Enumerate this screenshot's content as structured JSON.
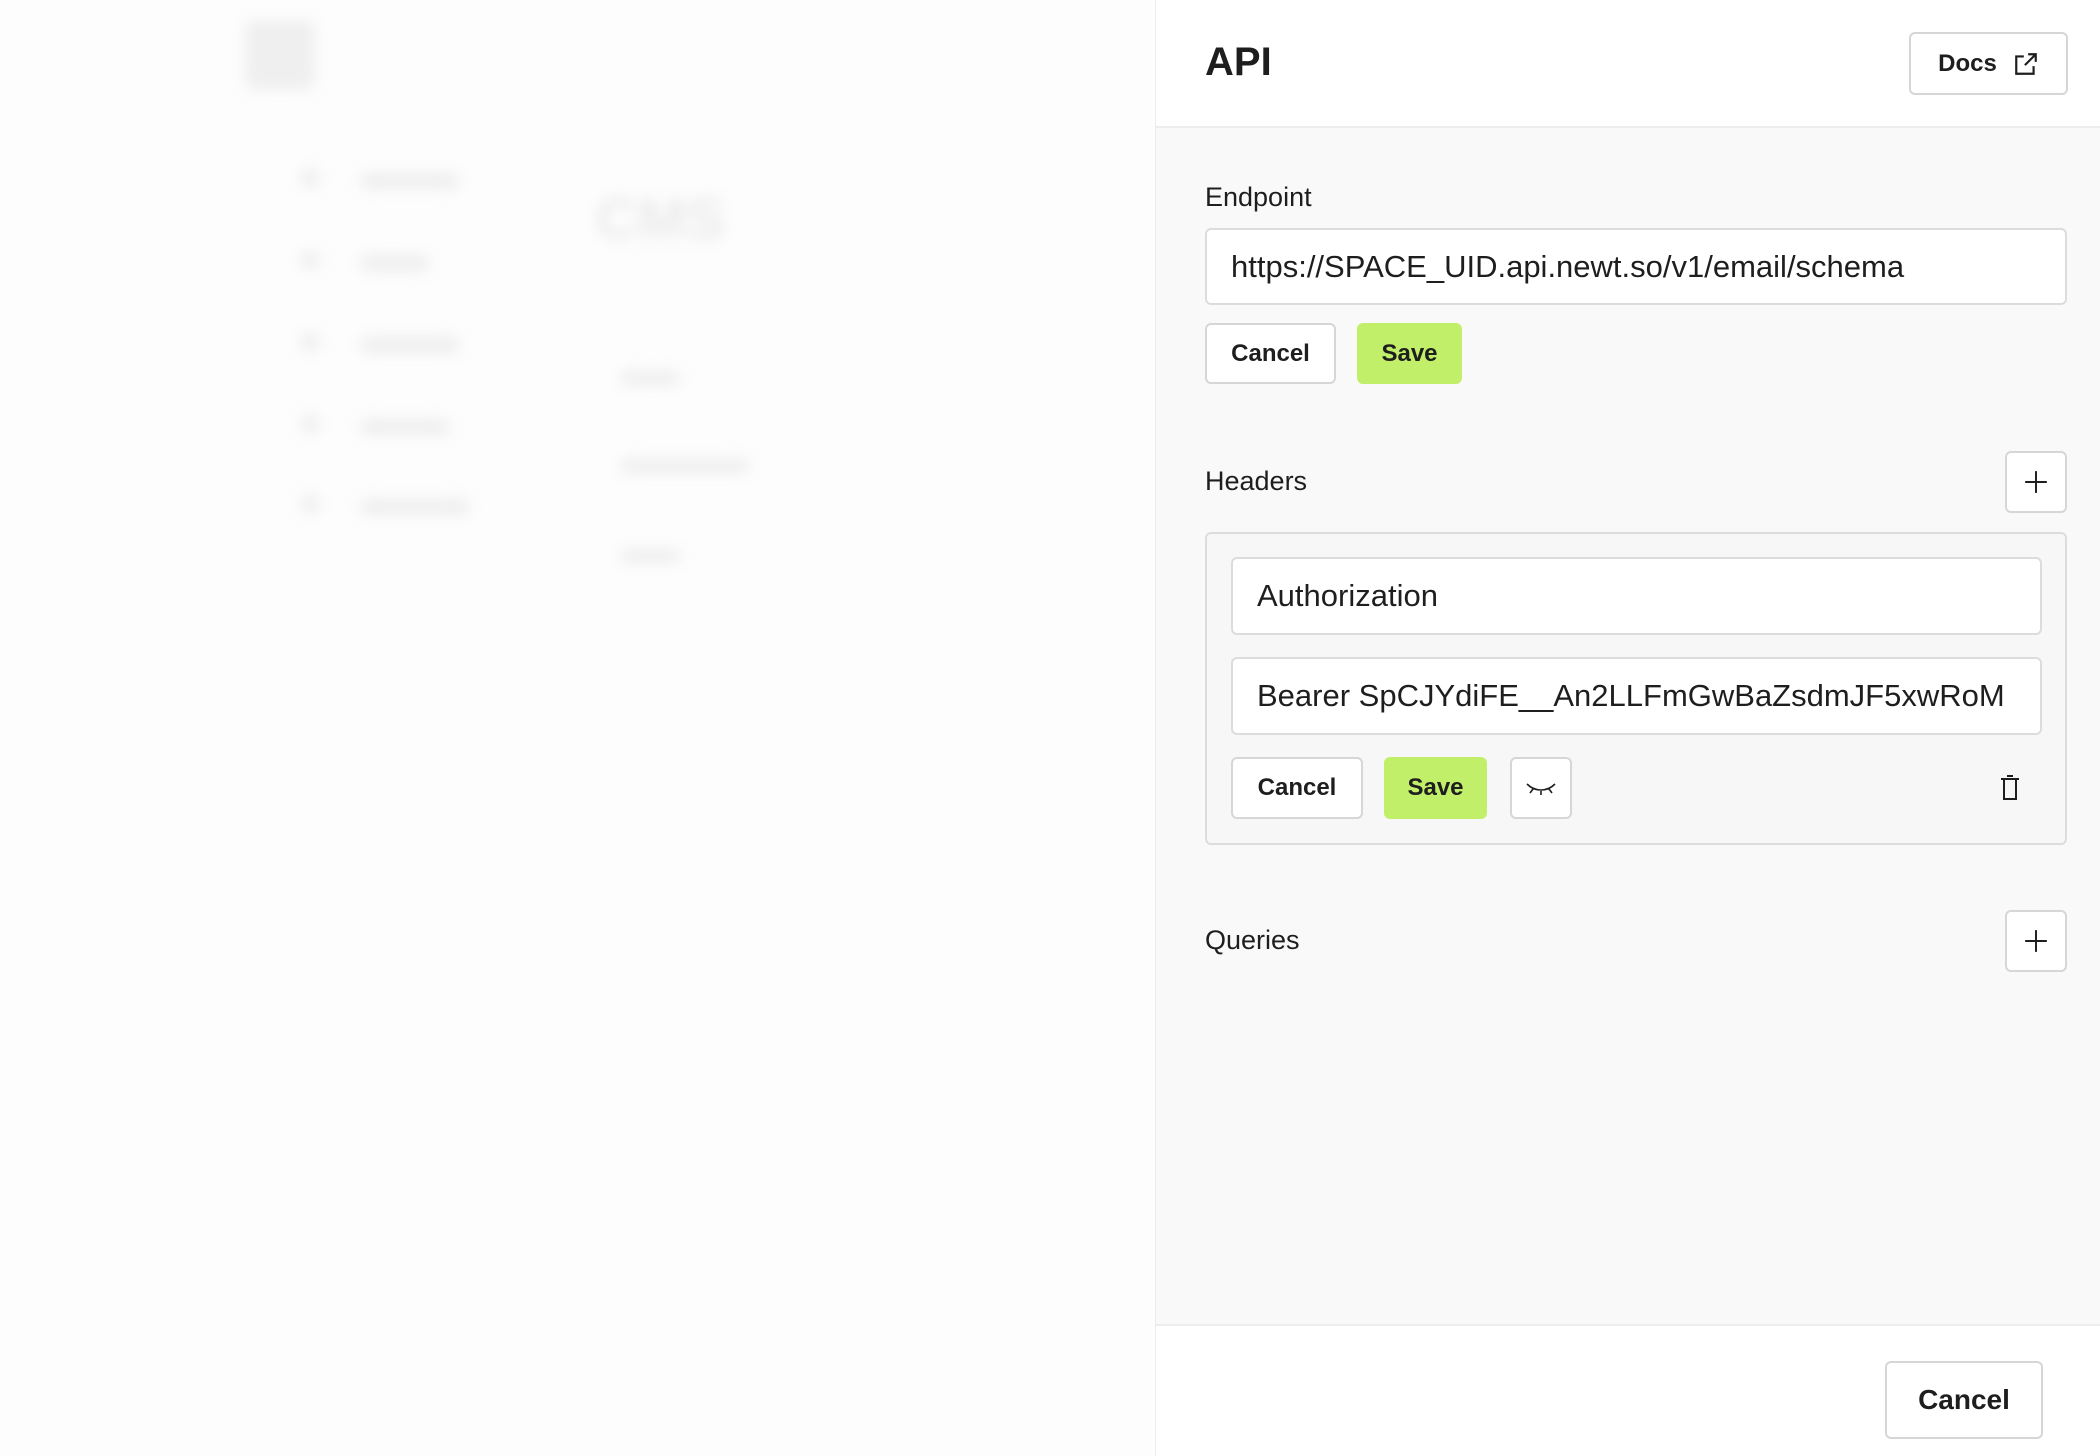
{
  "background": {
    "heading": "CMS"
  },
  "panel": {
    "title": "API",
    "docs_label": "Docs",
    "endpoint": {
      "label": "Endpoint",
      "value": "https://SPACE_UID.api.newt.so/v1/email/schema",
      "cancel": "Cancel",
      "save": "Save"
    },
    "headers": {
      "label": "Headers",
      "key": "Authorization",
      "value": "Bearer SpCJYdiFE__An2LLFmGwBaZsdmJF5xwRoM",
      "cancel": "Cancel",
      "save": "Save"
    },
    "queries": {
      "label": "Queries"
    },
    "footer_cancel": "Cancel"
  },
  "colors": {
    "accent": "#c2ef6a"
  }
}
